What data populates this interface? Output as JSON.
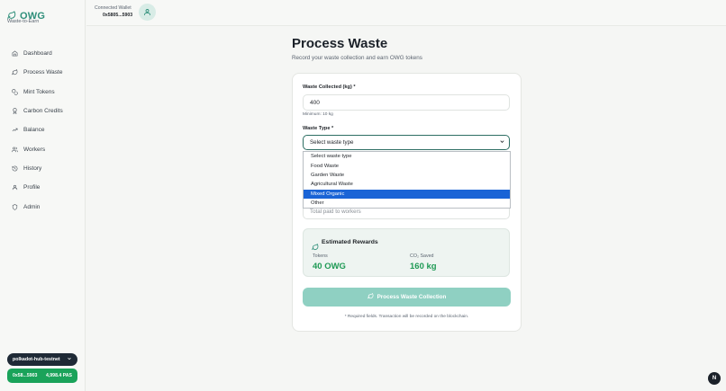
{
  "brand": {
    "name": "OWG",
    "tagline": "Waste-to-Earn",
    "icon": "leaf-icon"
  },
  "sidebar": {
    "items": [
      {
        "label": "Dashboard",
        "icon": "home-icon"
      },
      {
        "label": "Process Waste",
        "icon": "leaf-icon"
      },
      {
        "label": "Mint Tokens",
        "icon": "coins-icon"
      },
      {
        "label": "Carbon Credits",
        "icon": "award-icon"
      },
      {
        "label": "Balance",
        "icon": "trend-icon"
      },
      {
        "label": "Workers",
        "icon": "users-icon"
      },
      {
        "label": "History",
        "icon": "history-icon"
      },
      {
        "label": "Profile",
        "icon": "user-icon"
      },
      {
        "label": "Admin",
        "icon": "shield-icon"
      }
    ],
    "network_label": "polkadot-hub-testnet",
    "wallet_short": "0x58...5903",
    "wallet_balance": "4,998.4 PAS"
  },
  "header": {
    "connected_label": "Connected Wallet",
    "connected_address": "0x5805...5903"
  },
  "page": {
    "title": "Process Waste",
    "subtitle": "Record your waste collection and earn OWG tokens"
  },
  "form": {
    "waste_label": "Waste Collected (kg) *",
    "waste_value": "400",
    "waste_hint": "Minimum: 10 kg",
    "type_label": "Waste Type *",
    "type_selected": "Select waste type",
    "type_options": [
      "Select waste type",
      "Food Waste",
      "Garden Waste",
      "Agricultural Waste",
      "Mixed Organic",
      "Other"
    ],
    "highlighted_option": "Mixed Organic",
    "paid_placeholder": "Total paid to workers"
  },
  "rewards": {
    "title": "Estimated Rewards",
    "tokens_label": "Tokens",
    "tokens_value": "40 OWG",
    "co2_label": "CO₂ Saved",
    "co2_value": "160 kg"
  },
  "submit_label": "Process Waste Collection",
  "footnote": "* Required fields. Transaction will be recorded on the blockchain.",
  "fab_label": "N",
  "colors": {
    "accent": "#2f8f7a",
    "success": "#1aa35a",
    "highlight": "#1a64d6"
  }
}
